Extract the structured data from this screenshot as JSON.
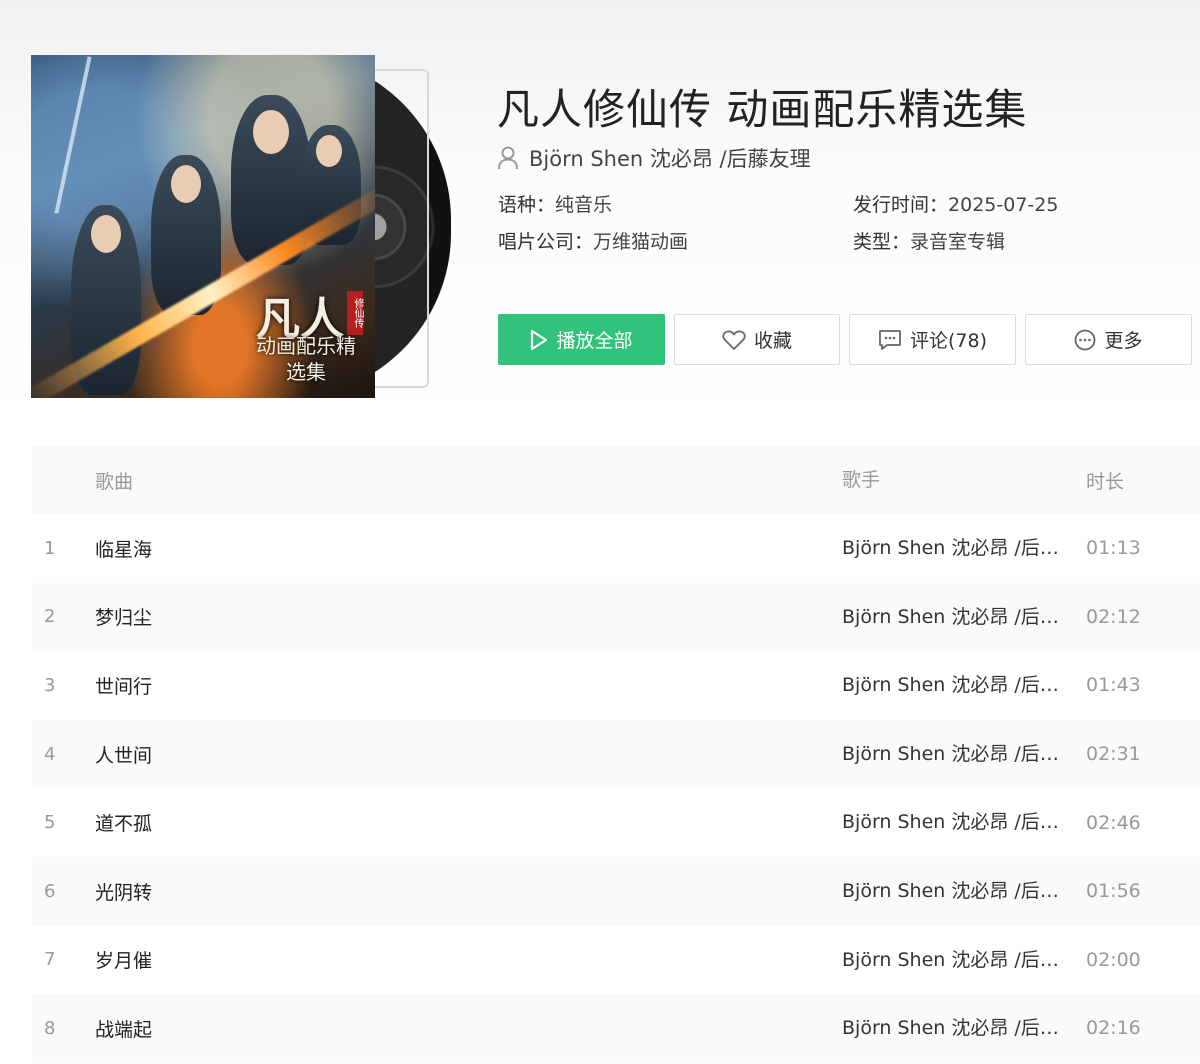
{
  "album": {
    "title": "凡人修仙传 动画配乐精选集",
    "artist": "Björn Shen 沈必昂 /后藤友理",
    "cover_text": {
      "main": "凡人",
      "sub": "动画配乐精选集",
      "seal": "修仙传"
    },
    "meta": [
      {
        "key": "语种：",
        "value": "纯音乐"
      },
      {
        "key": "发行时间：",
        "value": "2025-07-25"
      },
      {
        "key": "唱片公司：",
        "value": "万维猫动画"
      },
      {
        "key": "类型：",
        "value": "录音室专辑"
      }
    ]
  },
  "actions": {
    "play_all": "播放全部",
    "favorite": "收藏",
    "comment": "评论(78)",
    "more": "更多"
  },
  "table": {
    "headers": {
      "song": "歌曲",
      "artist": "歌手",
      "duration": "时长"
    },
    "rows": [
      {
        "index": "1",
        "name": "临星海",
        "artist": "Björn Shen 沈必昂 /后藤友理",
        "duration": "01:13"
      },
      {
        "index": "2",
        "name": "梦归尘",
        "artist": "Björn Shen 沈必昂 /后藤友理",
        "duration": "02:12"
      },
      {
        "index": "3",
        "name": "世间行",
        "artist": "Björn Shen 沈必昂 /后藤友理",
        "duration": "01:43"
      },
      {
        "index": "4",
        "name": "人世间",
        "artist": "Björn Shen 沈必昂 /后藤友理",
        "duration": "02:31"
      },
      {
        "index": "5",
        "name": "道不孤",
        "artist": "Björn Shen 沈必昂 /后藤友理",
        "duration": "02:46"
      },
      {
        "index": "6",
        "name": "光阴转",
        "artist": "Björn Shen 沈必昂 /后藤友理",
        "duration": "01:56"
      },
      {
        "index": "7",
        "name": "岁月催",
        "artist": "Björn Shen 沈必昂 /后藤友理",
        "duration": "02:00"
      },
      {
        "index": "8",
        "name": "战端起",
        "artist": "Björn Shen 沈必昂 /后藤友理",
        "duration": "02:16"
      }
    ]
  },
  "colors": {
    "accent": "#31c27c"
  },
  "icons": {
    "artist": "user-icon",
    "play": "play-icon",
    "favorite": "heart-icon",
    "comment": "comment-icon",
    "more": "more-icon"
  }
}
